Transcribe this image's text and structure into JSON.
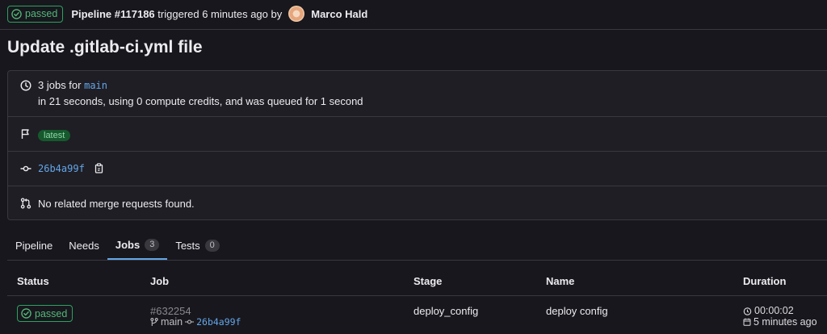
{
  "header": {
    "status": "passed",
    "pipeline_label": "Pipeline #117186",
    "triggered_text": "triggered 6 minutes ago by",
    "author": "Marco Hald"
  },
  "title": "Update .gitlab-ci.yml file",
  "info": {
    "jobs_prefix": "3 jobs for",
    "branch": "main",
    "duration_text": "in 21 seconds, using 0 compute credits, and was queued for 1 second",
    "latest_tag": "latest",
    "commit_sha": "26b4a99f",
    "merge_requests_text": "No related merge requests found."
  },
  "tabs": [
    {
      "label": "Pipeline"
    },
    {
      "label": "Needs"
    },
    {
      "label": "Jobs",
      "count": "3"
    },
    {
      "label": "Tests",
      "count": "0"
    }
  ],
  "table": {
    "headers": [
      "Status",
      "Job",
      "Stage",
      "Name",
      "Duration"
    ],
    "rows": [
      {
        "status": "passed",
        "job_id": "#632254",
        "ref": "main",
        "sha": "26b4a99f",
        "stage": "deploy_config",
        "name": "deploy config",
        "duration": "00:00:02",
        "finished": "5 minutes ago"
      }
    ]
  },
  "colors": {
    "background": "#18171d",
    "success": "#2da160",
    "link": "#63a6e9",
    "tag_bg": "#16592d"
  }
}
